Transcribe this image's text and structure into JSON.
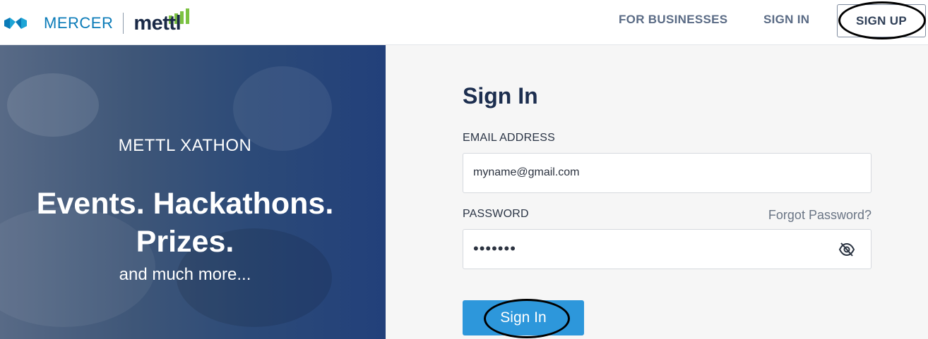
{
  "header": {
    "brand_left": "MERCER",
    "brand_right": "mettl",
    "nav": {
      "for_businesses": "FOR BUSINESSES",
      "sign_in": "SIGN IN",
      "sign_up": "SIGN UP"
    }
  },
  "hero": {
    "eyebrow": "METTL XATHON",
    "title_line1": "Events. Hackathons.",
    "title_line2": "Prizes.",
    "subtitle": "and much more..."
  },
  "form": {
    "title": "Sign In",
    "email_label": "EMAIL ADDRESS",
    "email_value": "myname@gmail.com",
    "password_label": "PASSWORD",
    "forgot_link": "Forgot Password?",
    "password_masked": "•••••••",
    "password_toggle_icon": "eye-off-icon",
    "submit_label": "Sign In"
  },
  "colors": {
    "accent": "#2d97db",
    "heading": "#1c2e4f",
    "mercer_blue": "#0a7bb8",
    "mettl_green": "#7cc242"
  }
}
